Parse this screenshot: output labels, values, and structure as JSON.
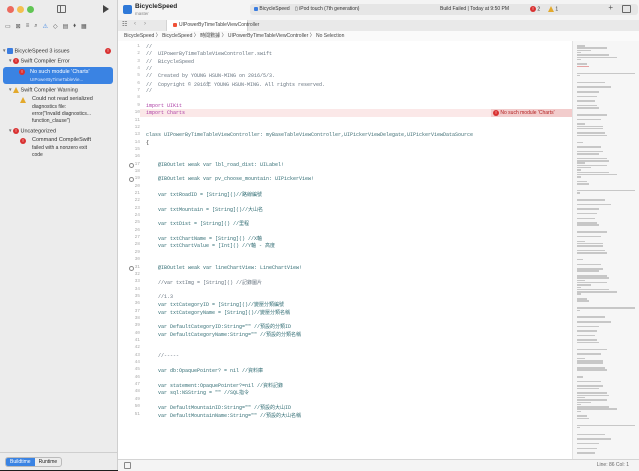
{
  "toolbar": {
    "app_title": "BicycleSpeed",
    "app_subtitle": "master",
    "breadcrumb_scheme": "BicycleSpeed",
    "breadcrumb_device": "iPod touch (7th generation)",
    "build_status": "Build Failed | Today at 9:50 PM",
    "error_count": "2",
    "warning_count": "1"
  },
  "tab": {
    "label": "UIPowerByTimeTableViewController"
  },
  "jumpbar": {
    "path": "BicycleSpeed 〉 BicycleSpeed 〉 時間數據 〉 UIPowerByTimeTableViewController 〉 No Selection"
  },
  "navigator": {
    "items": [
      {
        "label": "BicycleSpeed 3 issues",
        "kind": "project"
      },
      {
        "label": "Swift Compiler Error",
        "kind": "error-group"
      },
      {
        "label": "No such module 'Charts'",
        "kind": "error",
        "detail": "UIPowerByTimeTableVie..."
      },
      {
        "label": "Swift Compiler Warning",
        "kind": "warning-group"
      },
      {
        "label": "Could not read serialized",
        "kind": "warning",
        "detail1": "diagnostics file:",
        "detail2": "error(\"Invalid diagnostics...",
        "detail3": "function_clause\")"
      },
      {
        "label": "Uncategorized",
        "kind": "error-group"
      },
      {
        "label": "Command CompileSwift",
        "kind": "error",
        "detail1": "failed with a nonzero exit",
        "detail2": "code"
      }
    ],
    "filter_buttons": [
      "Buildtime",
      "Runtime"
    ]
  },
  "editor": {
    "error_banner": "No such module 'Charts'",
    "lines": [
      {
        "n": "1",
        "t": "//",
        "cls": "c-comment"
      },
      {
        "n": "2",
        "t": "//  UIPowerByTimeTableViewController.swift",
        "cls": "c-comment"
      },
      {
        "n": "3",
        "t": "//  BicycleSpeed",
        "cls": "c-comment"
      },
      {
        "n": "4",
        "t": "//",
        "cls": "c-comment"
      },
      {
        "n": "5",
        "t": "//  Created by YOUNG HSUN-MING on 2016/5/3.",
        "cls": "c-comment"
      },
      {
        "n": "6",
        "t": "//  Copyright © 2016年 YOUNG HSUN-MING. All rights reserved.",
        "cls": "c-comment"
      },
      {
        "n": "7",
        "t": "//",
        "cls": "c-comment"
      },
      {
        "n": "8",
        "t": "",
        "cls": ""
      },
      {
        "n": "9",
        "t": "import UIKit",
        "cls": "c-kw"
      },
      {
        "n": "10",
        "t": "import Charts",
        "cls": "c-kw"
      },
      {
        "n": "11",
        "t": "",
        "cls": ""
      },
      {
        "n": "12",
        "t": "",
        "cls": ""
      },
      {
        "n": "13",
        "t": "class UIPowerByTimeTableViewController: myBaseTableViewController,UIPickerViewDelegate,UIPickerViewDataSource",
        "cls": "c-type"
      },
      {
        "n": "14",
        "t": "{",
        "cls": ""
      },
      {
        "n": "15",
        "t": "",
        "cls": ""
      },
      {
        "n": "16",
        "t": "",
        "cls": ""
      },
      {
        "n": "17",
        "t": "    @IBOutlet weak var lbl_road_dist: UILabel!",
        "cls": "c-prop"
      },
      {
        "n": "18",
        "t": "",
        "cls": ""
      },
      {
        "n": "19",
        "t": "    @IBOutlet weak var pv_choose_mountain: UIPickerView!",
        "cls": "c-prop"
      },
      {
        "n": "20",
        "t": "",
        "cls": ""
      },
      {
        "n": "21",
        "t": "    var txtRoadID = [String]()//路線編號",
        "cls": "c-prop"
      },
      {
        "n": "22",
        "t": "",
        "cls": ""
      },
      {
        "n": "23",
        "t": "    var txtMountain = [String]()//大山名",
        "cls": "c-prop"
      },
      {
        "n": "24",
        "t": "",
        "cls": ""
      },
      {
        "n": "25",
        "t": "    var txtDist = [String]() //里程",
        "cls": "c-prop"
      },
      {
        "n": "26",
        "t": "",
        "cls": ""
      },
      {
        "n": "27",
        "t": "    var txtChartName = [String]() //X軸",
        "cls": "c-prop"
      },
      {
        "n": "28",
        "t": "    var txtChartValue = [Int]() //Y軸 - 高度",
        "cls": "c-prop"
      },
      {
        "n": "29",
        "t": "",
        "cls": ""
      },
      {
        "n": "30",
        "t": "",
        "cls": ""
      },
      {
        "n": "31",
        "t": "    @IBOutlet weak var lineChartView: LineChartView!",
        "cls": "c-prop"
      },
      {
        "n": "32",
        "t": "",
        "cls": ""
      },
      {
        "n": "33",
        "t": "    //var txtImg = [String]() //記錄圖片",
        "cls": "c-comment"
      },
      {
        "n": "34",
        "t": "",
        "cls": ""
      },
      {
        "n": "35",
        "t": "    //1.3",
        "cls": "c-comment"
      },
      {
        "n": "36",
        "t": "    var txtCategoryID = [String]()//變壓分類編號",
        "cls": "c-prop"
      },
      {
        "n": "37",
        "t": "    var txtCategoryName = [String]()//變壓分類名稱",
        "cls": "c-prop"
      },
      {
        "n": "38",
        "t": "",
        "cls": ""
      },
      {
        "n": "39",
        "t": "    var DefaultCategoryID:String=\"\" //預設的分類ID",
        "cls": "c-prop"
      },
      {
        "n": "40",
        "t": "    var DefaultCategoryName:String=\"\" //預設的分類名稱",
        "cls": "c-prop"
      },
      {
        "n": "41",
        "t": "",
        "cls": ""
      },
      {
        "n": "42",
        "t": "",
        "cls": ""
      },
      {
        "n": "43",
        "t": "    //-----",
        "cls": "c-comment"
      },
      {
        "n": "44",
        "t": "",
        "cls": ""
      },
      {
        "n": "45",
        "t": "    var db:OpaquePointer? = nil //資料庫",
        "cls": "c-prop"
      },
      {
        "n": "46",
        "t": "",
        "cls": ""
      },
      {
        "n": "47",
        "t": "    var statement:OpaquePointer?=nil //資料記錄",
        "cls": "c-prop"
      },
      {
        "n": "48",
        "t": "    var sql:NSString = \"\" //SQL指令",
        "cls": "c-prop"
      },
      {
        "n": "49",
        "t": "",
        "cls": ""
      },
      {
        "n": "50",
        "t": "    var DefaultMountainID:String=\"\" //預設的大山ID",
        "cls": "c-prop"
      },
      {
        "n": "51",
        "t": "    var DefaultMountainName:String=\"\" //預設的大山名稱",
        "cls": "c-prop"
      }
    ]
  },
  "statusbar": {
    "position": "Line: 86  Col: 1"
  },
  "colors": {
    "accent": "#3a83e3",
    "error": "#d93131",
    "warning": "#e3a92c"
  }
}
